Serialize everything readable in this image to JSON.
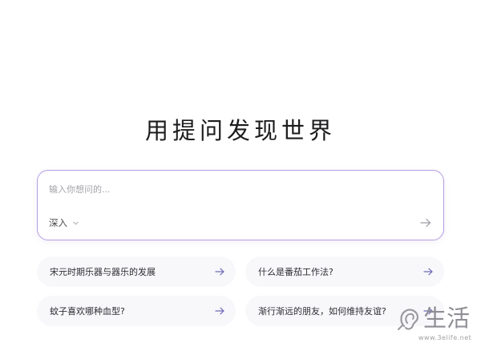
{
  "main": {
    "title": "用提问发现世界"
  },
  "search": {
    "placeholder": "输入你想问的...",
    "mode_label": "深入"
  },
  "suggestions": [
    {
      "text": "宋元时期乐器与器乐的发展"
    },
    {
      "text": "什么是番茄工作法?"
    },
    {
      "text": "蚊子喜欢哪种血型?"
    },
    {
      "text": "渐行渐远的朋友，如何维持友谊?"
    }
  ],
  "watermark": {
    "text": "生活",
    "url": "www.3elife.net"
  },
  "colors": {
    "accent_border": "#b59ce0",
    "arrow": "#6e6ab8",
    "suggestion_bg": "#f8f8fb"
  },
  "icons": {
    "mode_chevron": "chevron-down-icon",
    "submit": "arrow-right-icon",
    "suggestion_arrow": "arrow-right-icon",
    "watermark_logo": "ear-logo-icon"
  }
}
